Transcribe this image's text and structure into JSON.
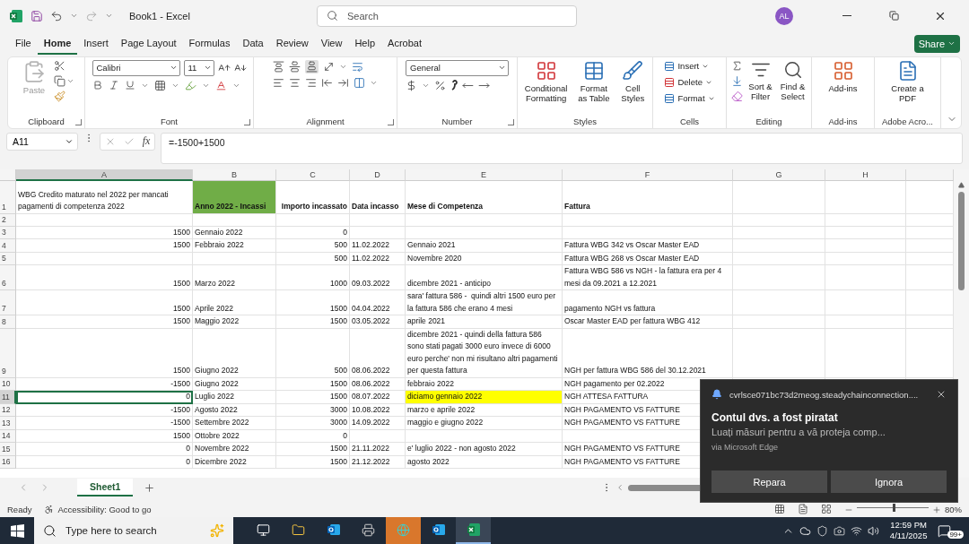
{
  "titlebar": {
    "doc_title": "Book1  -  Excel",
    "search_placeholder": "Search",
    "avatar": "AL"
  },
  "menu_tabs": [
    {
      "label": "File",
      "selected": false
    },
    {
      "label": "Home",
      "selected": true
    },
    {
      "label": "Insert",
      "selected": false
    },
    {
      "label": "Page Layout",
      "selected": false
    },
    {
      "label": "Formulas",
      "selected": false
    },
    {
      "label": "Data",
      "selected": false
    },
    {
      "label": "Review",
      "selected": false
    },
    {
      "label": "View",
      "selected": false
    },
    {
      "label": "Help",
      "selected": false
    },
    {
      "label": "Acrobat",
      "selected": false
    }
  ],
  "share": "Share",
  "ribbon": {
    "clipboard": {
      "label": "Clipboard",
      "paste": {
        "label": "Paste",
        "disabled": true
      }
    },
    "font": {
      "label": "Font",
      "font_name": "Calibri",
      "font_size": "11"
    },
    "alignment": {
      "label": "Alignment"
    },
    "number": {
      "label": "Number",
      "format": "General"
    },
    "styles": {
      "label": "Styles",
      "buttons": [
        "Conditional Formatting",
        "Format as Table",
        "Cell Styles"
      ]
    },
    "cells": {
      "label": "Cells",
      "buttons": [
        "Insert",
        "Delete",
        "Format"
      ]
    },
    "editing": {
      "label": "Editing",
      "buttons": [
        "Sort & Filter",
        "Find & Select"
      ]
    },
    "addins": {
      "label": "Add-ins",
      "buttons": [
        "Add-ins"
      ]
    },
    "adobe": {
      "label": "Adobe Acro...",
      "buttons": [
        "Create a PDF"
      ]
    }
  },
  "formula_bar": {
    "name_box": "A11",
    "fx": "fx",
    "formula": "=-1500+1500"
  },
  "columns": [
    {
      "label": "A",
      "selected": true
    },
    {
      "label": "B",
      "selected": false
    },
    {
      "label": "C",
      "selected": false
    },
    {
      "label": "D",
      "selected": false
    },
    {
      "label": "E",
      "selected": false
    },
    {
      "label": "F",
      "selected": false
    },
    {
      "label": "G",
      "selected": false
    },
    {
      "label": "H",
      "selected": false
    }
  ],
  "rows": [
    {
      "header": "1",
      "selected": false,
      "cells": [
        {
          "text": "WBG Credito maturato nel 2022 per mancati pagamenti di competenza 2022",
          "bold": false
        },
        {
          "text": "Anno 2022 - Incassi",
          "bold": true,
          "color": "#70ad47"
        },
        {
          "text": "Importo incassato",
          "bold": true
        },
        {
          "text": "Data incasso",
          "bold": true
        },
        {
          "text": "Mese di Competenza",
          "bold": true
        },
        {
          "text": "Fattura",
          "bold": true
        }
      ]
    },
    {
      "header": "2",
      "selected": false,
      "cells": [
        null,
        null,
        null,
        null,
        null,
        null
      ]
    },
    {
      "header": "3",
      "selected": false,
      "cells": [
        {
          "text": "1500",
          "bold": false
        },
        {
          "text": "Gennaio 2022",
          "bold": false
        },
        {
          "text": "0",
          "bold": false
        },
        null,
        null,
        null
      ]
    },
    {
      "header": "4",
      "selected": false,
      "cells": [
        {
          "text": "1500",
          "bold": false
        },
        {
          "text": "Febbraio 2022",
          "bold": false
        },
        {
          "text": "500",
          "bold": false
        },
        {
          "text": "11.02.2022",
          "bold": false
        },
        {
          "text": "Gennaio 2021",
          "bold": false
        },
        {
          "text": "Fattura WBG 342 vs Oscar Master EAD",
          "bold": false
        }
      ]
    },
    {
      "header": "5",
      "selected": false,
      "cells": [
        null,
        null,
        {
          "text": "500",
          "bold": false
        },
        {
          "text": "11.02.2022",
          "bold": false
        },
        {
          "text": "Novembre 2020",
          "bold": false
        },
        {
          "text": "Fattura WBG 268 vs Oscar Master EAD",
          "bold": false
        }
      ]
    },
    {
      "header": "6",
      "selected": false,
      "cells": [
        {
          "text": "1500",
          "bold": false
        },
        {
          "text": "Marzo 2022",
          "bold": false
        },
        {
          "text": "1000",
          "bold": false
        },
        {
          "text": "09.03.2022",
          "bold": false
        },
        {
          "text": "dicembre 2021 - anticipo",
          "bold": false
        },
        {
          "text": "Fattura WBG 586 vs NGH - la fattura era per 4 mesi da 09.2021 a 12.2021",
          "bold": false
        }
      ]
    },
    {
      "header": "7",
      "selected": false,
      "cells": [
        {
          "text": "1500",
          "bold": false
        },
        {
          "text": "Aprile 2022",
          "bold": false
        },
        {
          "text": "1500",
          "bold": false
        },
        {
          "text": "04.04.2022",
          "bold": false
        },
        {
          "text": "sara' fattura 586 -  quindi altri 1500 euro per la fattura 586 che erano 4 mesi",
          "bold": false
        },
        {
          "text": "pagamento NGH vs fattura",
          "bold": false
        }
      ]
    },
    {
      "header": "8",
      "selected": false,
      "cells": [
        {
          "text": "1500",
          "bold": false
        },
        {
          "text": "Maggio 2022",
          "bold": false
        },
        {
          "text": "1500",
          "bold": false
        },
        {
          "text": "03.05.2022",
          "bold": false
        },
        {
          "text": "aprile 2021",
          "bold": false
        },
        {
          "text": "Oscar Master EAD per fattura WBG 412",
          "bold": false
        }
      ]
    },
    {
      "header": "9",
      "selected": false,
      "cells": [
        {
          "text": "1500",
          "bold": false
        },
        {
          "text": "Giugno 2022",
          "bold": false
        },
        {
          "text": "500",
          "bold": false
        },
        {
          "text": "08.06.2022",
          "bold": false
        },
        {
          "text": "dicembre 2021 - quindi della fattura 586 sono stati pagati 3000 euro invece di 6000 euro perche' non mi risultano altri pagamenti per questa fattura",
          "bold": false
        },
        {
          "text": "NGH per fattura WBG 586 del 30.12.2021",
          "bold": false
        }
      ]
    },
    {
      "header": "10",
      "selected": false,
      "cells": [
        {
          "text": "-1500",
          "bold": false
        },
        {
          "text": "Giugno 2022",
          "bold": false
        },
        {
          "text": "1500",
          "bold": false
        },
        {
          "text": "08.06.2022",
          "bold": false
        },
        {
          "text": "febbraio 2022",
          "bold": false
        },
        {
          "text": "NGH pagamento per 02.2022",
          "bold": false
        }
      ]
    },
    {
      "header": "11",
      "selected": true,
      "cells": [
        {
          "text": "0",
          "bold": false
        },
        {
          "text": "Luglio 2022",
          "bold": false
        },
        {
          "text": "1500",
          "bold": false
        },
        {
          "text": "08.07.2022",
          "bold": false
        },
        {
          "text": "diciamo gennaio 2022",
          "bold": false,
          "color": "#ffff00"
        },
        {
          "text": "NGH ATTESA FATTURA",
          "bold": false
        }
      ]
    },
    {
      "header": "12",
      "selected": false,
      "cells": [
        {
          "text": "-1500",
          "bold": false
        },
        {
          "text": "Agosto 2022",
          "bold": false
        },
        {
          "text": "3000",
          "bold": false
        },
        {
          "text": "10.08.2022",
          "bold": false
        },
        {
          "text": "marzo e aprile 2022",
          "bold": false
        },
        {
          "text": "NGH PAGAMENTO VS FATTURE",
          "bold": false
        }
      ]
    },
    {
      "header": "13",
      "selected": false,
      "cells": [
        {
          "text": "-1500",
          "bold": false
        },
        {
          "text": "Settembre 2022",
          "bold": false
        },
        {
          "text": "3000",
          "bold": false
        },
        {
          "text": "14.09.2022",
          "bold": false
        },
        {
          "text": "maggio e giugno 2022",
          "bold": false
        },
        {
          "text": "NGH PAGAMENTO VS FATTURE",
          "bold": false
        }
      ]
    },
    {
      "header": "14",
      "selected": false,
      "cells": [
        {
          "text": "1500",
          "bold": false
        },
        {
          "text": "Ottobre 2022",
          "bold": false
        },
        {
          "text": "0",
          "bold": false
        },
        null,
        null,
        null
      ]
    },
    {
      "header": "15",
      "selected": false,
      "cells": [
        {
          "text": "0",
          "bold": false
        },
        {
          "text": "Novembre 2022",
          "bold": false
        },
        {
          "text": "1500",
          "bold": false
        },
        {
          "text": "21.11.2022",
          "bold": false
        },
        {
          "text": "e' luglio 2022 - non agosto 2022",
          "bold": false
        },
        {
          "text": "NGH PAGAMENTO VS FATTURE",
          "bold": false
        }
      ]
    },
    {
      "header": "16",
      "selected": false,
      "cells": [
        {
          "text": "0",
          "bold": false
        },
        {
          "text": "Dicembre 2022",
          "bold": false
        },
        {
          "text": "1500",
          "bold": false
        },
        {
          "text": "21.12.2022",
          "bold": false
        },
        {
          "text": "agosto 2022",
          "bold": false
        },
        {
          "text": "NGH PAGAMENTO VS FATTURE",
          "bold": false
        }
      ]
    }
  ],
  "sheet_tabs": [
    {
      "label": "Sheet1",
      "selected": true
    }
  ],
  "status_bar": {
    "ready": "Ready",
    "accessibility": "Accessibility: Good to go",
    "zoom": "80%",
    "zoom_slider": {
      "level": 0.5
    }
  },
  "notification": {
    "source": "cvrlsce071bc73d2meog.steadychainconnection....",
    "title": "Contul dvs. a fost piratat",
    "body": "Luați măsuri pentru a vă proteja comp...",
    "via": "via Microsoft Edge",
    "buttons": [
      "Repara",
      "Ignora"
    ]
  },
  "taskbar": {
    "search_placeholder": "Type here to search",
    "apps": [
      {
        "selected": false,
        "flashing": false
      },
      {
        "selected": false,
        "flashing": false
      },
      {
        "selected": false,
        "flashing": false
      },
      {
        "selected": false,
        "flashing": false
      },
      {
        "selected": false,
        "flashing": true
      },
      {
        "selected": false,
        "flashing": false
      },
      {
        "selected": true,
        "flashing": false
      }
    ],
    "time": "12:59 PM",
    "date": "4/11/2025",
    "badge": "99+"
  }
}
